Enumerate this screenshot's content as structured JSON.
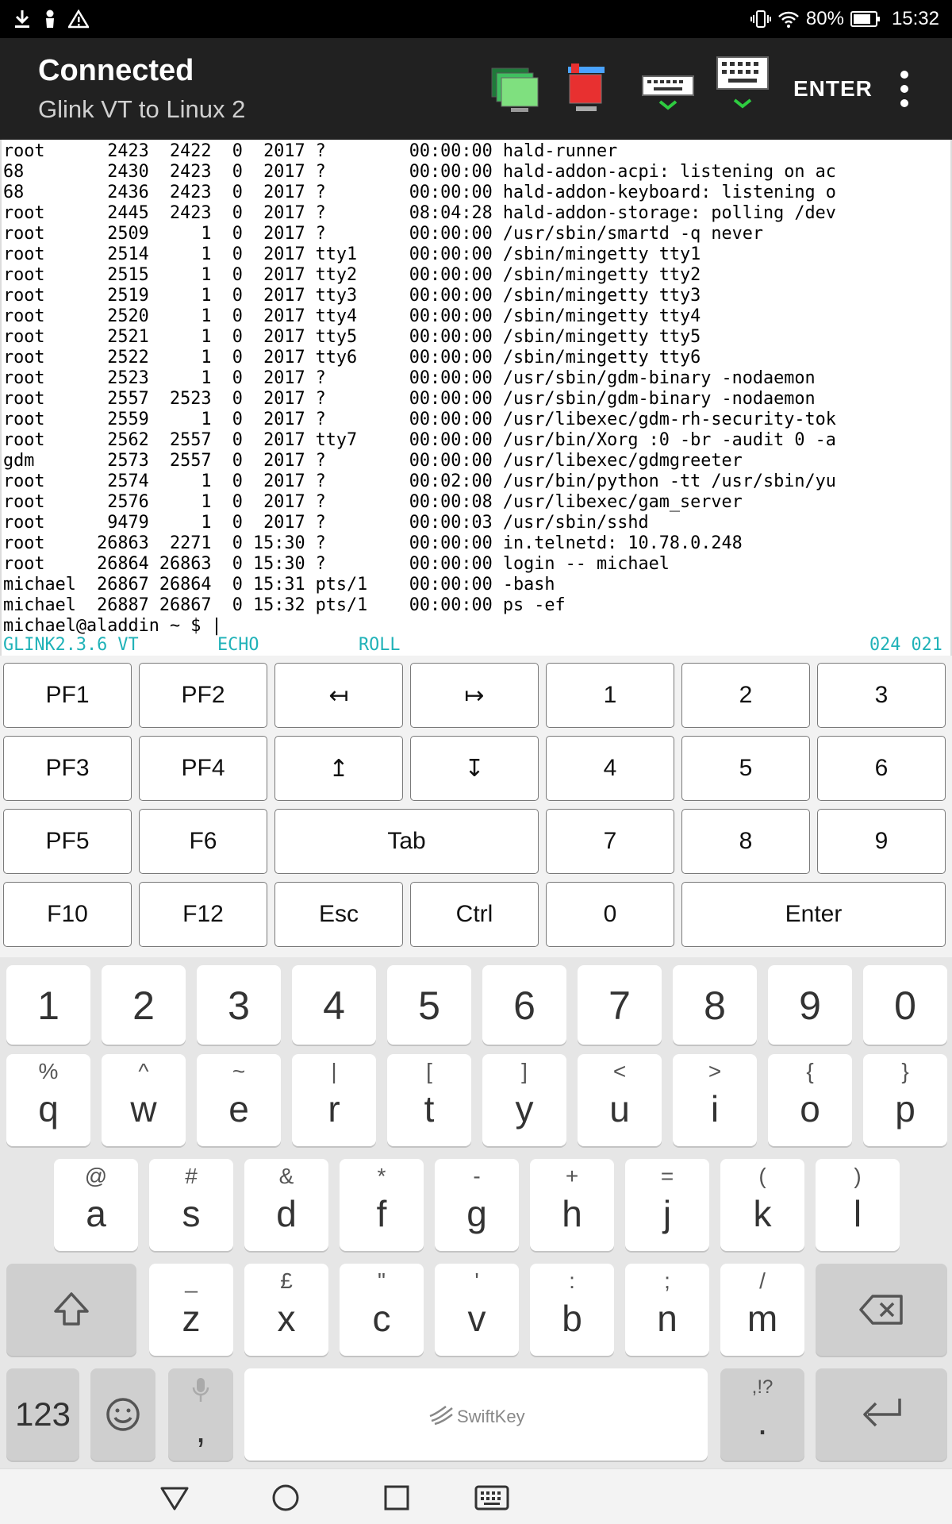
{
  "status_bar": {
    "battery": "80%",
    "time": "15:32",
    "icons": [
      "download-icon",
      "person-icon",
      "warning-icon",
      "vibrate-icon",
      "wifi-icon",
      "battery-icon"
    ]
  },
  "app_bar": {
    "title": "Connected",
    "subtitle": "Glink VT to Linux 2",
    "enter_label": "ENTER",
    "tool_icons": [
      "sessions-icon",
      "disconnect-icon",
      "keyboard-hide-icon",
      "keyboard-show-icon",
      "more-vert-icon"
    ]
  },
  "terminal": {
    "lines": [
      "root      2423  2422  0  2017 ?        00:00:00 hald-runner",
      "68        2430  2423  0  2017 ?        00:00:00 hald-addon-acpi: listening on ac",
      "68        2436  2423  0  2017 ?        00:00:00 hald-addon-keyboard: listening o",
      "root      2445  2423  0  2017 ?        08:04:28 hald-addon-storage: polling /dev",
      "root      2509     1  0  2017 ?        00:00:00 /usr/sbin/smartd -q never",
      "root      2514     1  0  2017 tty1     00:00:00 /sbin/mingetty tty1",
      "root      2515     1  0  2017 tty2     00:00:00 /sbin/mingetty tty2",
      "root      2519     1  0  2017 tty3     00:00:00 /sbin/mingetty tty3",
      "root      2520     1  0  2017 tty4     00:00:00 /sbin/mingetty tty4",
      "root      2521     1  0  2017 tty5     00:00:00 /sbin/mingetty tty5",
      "root      2522     1  0  2017 tty6     00:00:00 /sbin/mingetty tty6",
      "root      2523     1  0  2017 ?        00:00:00 /usr/sbin/gdm-binary -nodaemon",
      "root      2557  2523  0  2017 ?        00:00:00 /usr/sbin/gdm-binary -nodaemon",
      "root      2559     1  0  2017 ?        00:00:00 /usr/libexec/gdm-rh-security-tok",
      "root      2562  2557  0  2017 tty7     00:00:00 /usr/bin/Xorg :0 -br -audit 0 -a",
      "gdm       2573  2557  0  2017 ?        00:00:00 /usr/libexec/gdmgreeter",
      "root      2574     1  0  2017 ?        00:02:00 /usr/bin/python -tt /usr/sbin/yu",
      "root      2576     1  0  2017 ?        00:00:08 /usr/libexec/gam_server",
      "root      9479     1  0  2017 ?        00:00:03 /usr/sbin/sshd",
      "root     26863  2271  0 15:30 ?        00:00:00 in.telnetd: 10.78.0.248",
      "root     26864 26863  0 15:30 ?        00:00:00 login -- michael",
      "michael  26867 26864  0 15:31 pts/1    00:00:00 -bash",
      "michael  26887 26867  0 15:32 pts/1    00:00:00 ps -ef",
      "michael@aladdin ~ $ |"
    ],
    "status": {
      "product": "GLINK2.3.6 VT",
      "echo": "ECHO",
      "roll": "ROLL",
      "cursor_pos": "024 021"
    }
  },
  "function_keys": {
    "rows": [
      [
        "PF1",
        "PF2",
        "↤",
        "↦",
        "1",
        "2",
        "3"
      ],
      [
        "PF3",
        "PF4",
        "↥",
        "↧",
        "4",
        "5",
        "6"
      ],
      [
        "PF5",
        "F6",
        "Tab",
        "7",
        "8",
        "9"
      ],
      [
        "F10",
        "F12",
        "Esc",
        "Ctrl",
        "0",
        "Enter"
      ]
    ]
  },
  "keyboard": {
    "number_row": [
      "1",
      "2",
      "3",
      "4",
      "5",
      "6",
      "7",
      "8",
      "9",
      "0"
    ],
    "row1": [
      {
        "main": "q",
        "sub": "%"
      },
      {
        "main": "w",
        "sub": "^"
      },
      {
        "main": "e",
        "sub": "~"
      },
      {
        "main": "r",
        "sub": "|"
      },
      {
        "main": "t",
        "sub": "["
      },
      {
        "main": "y",
        "sub": "]"
      },
      {
        "main": "u",
        "sub": "<"
      },
      {
        "main": "i",
        "sub": ">"
      },
      {
        "main": "o",
        "sub": "{"
      },
      {
        "main": "p",
        "sub": "}"
      }
    ],
    "row2": [
      {
        "main": "a",
        "sub": "@"
      },
      {
        "main": "s",
        "sub": "#"
      },
      {
        "main": "d",
        "sub": "&"
      },
      {
        "main": "f",
        "sub": "*"
      },
      {
        "main": "g",
        "sub": "-"
      },
      {
        "main": "h",
        "sub": "+"
      },
      {
        "main": "j",
        "sub": "="
      },
      {
        "main": "k",
        "sub": "("
      },
      {
        "main": "l",
        "sub": ")"
      }
    ],
    "row3": [
      {
        "main": "z",
        "sub": "_"
      },
      {
        "main": "x",
        "sub": "£"
      },
      {
        "main": "c",
        "sub": "\""
      },
      {
        "main": "v",
        "sub": "'"
      },
      {
        "main": "b",
        "sub": ":"
      },
      {
        "main": "n",
        "sub": ";"
      },
      {
        "main": "m",
        "sub": "/"
      }
    ],
    "bottom": {
      "numbers_label": "123",
      "comma_label": ",",
      "space_label": "SwiftKey",
      "period_label": ".",
      "period_sub": ",!?"
    }
  },
  "nav_bar": {
    "icons": [
      "back-icon",
      "home-icon",
      "recents-icon",
      "keyboard-switch-icon"
    ]
  }
}
